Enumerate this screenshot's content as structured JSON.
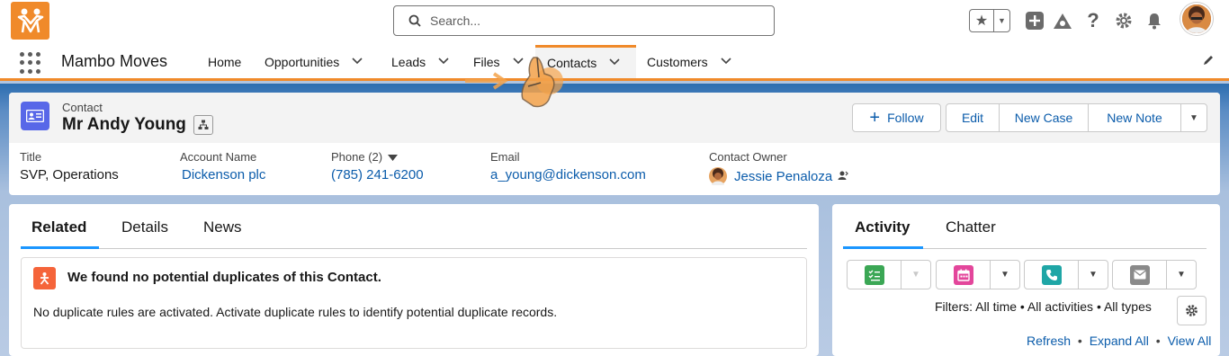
{
  "header": {
    "search_placeholder": "Search..."
  },
  "nav": {
    "app_name": "Mambo Moves",
    "items": [
      {
        "label": "Home"
      },
      {
        "label": "Opportunities"
      },
      {
        "label": "Leads"
      },
      {
        "label": "Files"
      },
      {
        "label": "Contacts"
      },
      {
        "label": "Customers"
      }
    ],
    "active": "Contacts"
  },
  "record": {
    "object_label": "Contact",
    "name": "Mr Andy Young",
    "actions": {
      "follow": "Follow",
      "edit": "Edit",
      "new_case": "New Case",
      "new_note": "New Note"
    },
    "fields": {
      "title_label": "Title",
      "title_value": "SVP, Operations",
      "account_label": "Account Name",
      "account_value": "Dickenson plc",
      "phone_label": "Phone (2)",
      "phone_value": "(785) 241-6200",
      "email_label": "Email",
      "email_value": "a_young@dickenson.com",
      "owner_label": "Contact Owner",
      "owner_value": "Jessie Penaloza"
    }
  },
  "left_card": {
    "tabs": [
      "Related",
      "Details",
      "News"
    ],
    "active_tab": "Related",
    "duplicates_title": "We found no potential duplicates of this Contact.",
    "duplicates_text": "No duplicate rules are activated. Activate duplicate rules to identify potential duplicate records."
  },
  "right_card": {
    "tabs": [
      "Activity",
      "Chatter"
    ],
    "active_tab": "Activity",
    "filters_text": "Filters: All time • All activities • All types",
    "links": {
      "refresh": "Refresh",
      "expand_all": "Expand All",
      "view_all": "View All"
    },
    "sep": "•"
  },
  "colors": {
    "brand_orange": "#f08a2a",
    "link_blue": "#0b5cab",
    "contact_icon": "#5867e8",
    "task_green": "#3ba755",
    "event_pink": "#e3469b",
    "call_teal": "#1fa6a6",
    "email_gray": "#8a8a8a"
  }
}
